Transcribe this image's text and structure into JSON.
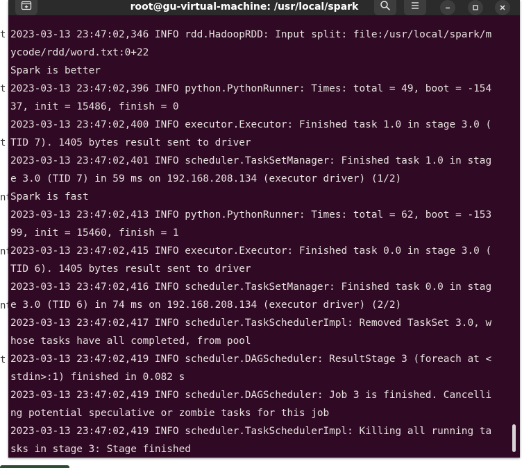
{
  "window": {
    "title": "root@gu-virtual-machine: /usr/local/spark"
  },
  "background_fragments": [
    "t",
    "t",
    "t",
    "nt",
    "nt",
    "nte",
    "t"
  ],
  "terminal": {
    "lines": [
      "2023-03-13 23:47:02,346 INFO rdd.HadoopRDD: Input split: file:/usr/local/spark/m",
      "ycode/rdd/word.txt:0+22",
      "Spark is better",
      "2023-03-13 23:47:02,396 INFO python.PythonRunner: Times: total = 49, boot = -154",
      "37, init = 15486, finish = 0",
      "2023-03-13 23:47:02,400 INFO executor.Executor: Finished task 1.0 in stage 3.0 (",
      "TID 7). 1405 bytes result sent to driver",
      "2023-03-13 23:47:02,401 INFO scheduler.TaskSetManager: Finished task 1.0 in stag",
      "e 3.0 (TID 7) in 59 ms on 192.168.208.134 (executor driver) (1/2)",
      "Spark is fast",
      "2023-03-13 23:47:02,413 INFO python.PythonRunner: Times: total = 62, boot = -153",
      "99, init = 15460, finish = 1",
      "2023-03-13 23:47:02,415 INFO executor.Executor: Finished task 0.0 in stage 3.0 (",
      "TID 6). 1405 bytes result sent to driver",
      "2023-03-13 23:47:02,416 INFO scheduler.TaskSetManager: Finished task 0.0 in stag",
      "e 3.0 (TID 6) in 74 ms on 192.168.208.134 (executor driver) (2/2)",
      "2023-03-13 23:47:02,417 INFO scheduler.TaskSchedulerImpl: Removed TaskSet 3.0, w",
      "hose tasks have all completed, from pool",
      "2023-03-13 23:47:02,419 INFO scheduler.DAGScheduler: ResultStage 3 (foreach at <",
      "stdin>:1) finished in 0.082 s",
      "2023-03-13 23:47:02,419 INFO scheduler.DAGScheduler: Job 3 is finished. Cancelli",
      "ng potential speculative or zombie tasks for this job",
      "2023-03-13 23:47:02,419 INFO scheduler.TaskSchedulerImpl: Killing all running ta",
      "sks in stage 3: Stage finished"
    ]
  },
  "colors": {
    "terminal_background": "#300a24",
    "terminal_foreground": "#e6e1de",
    "titlebar": "#2b2b2b"
  },
  "icons": {
    "new_tab": "new-tab-icon",
    "search": "search-icon",
    "menu": "hamburger-menu-icon",
    "minimize": "minimize-icon",
    "maximize": "maximize-icon",
    "close": "close-icon"
  }
}
